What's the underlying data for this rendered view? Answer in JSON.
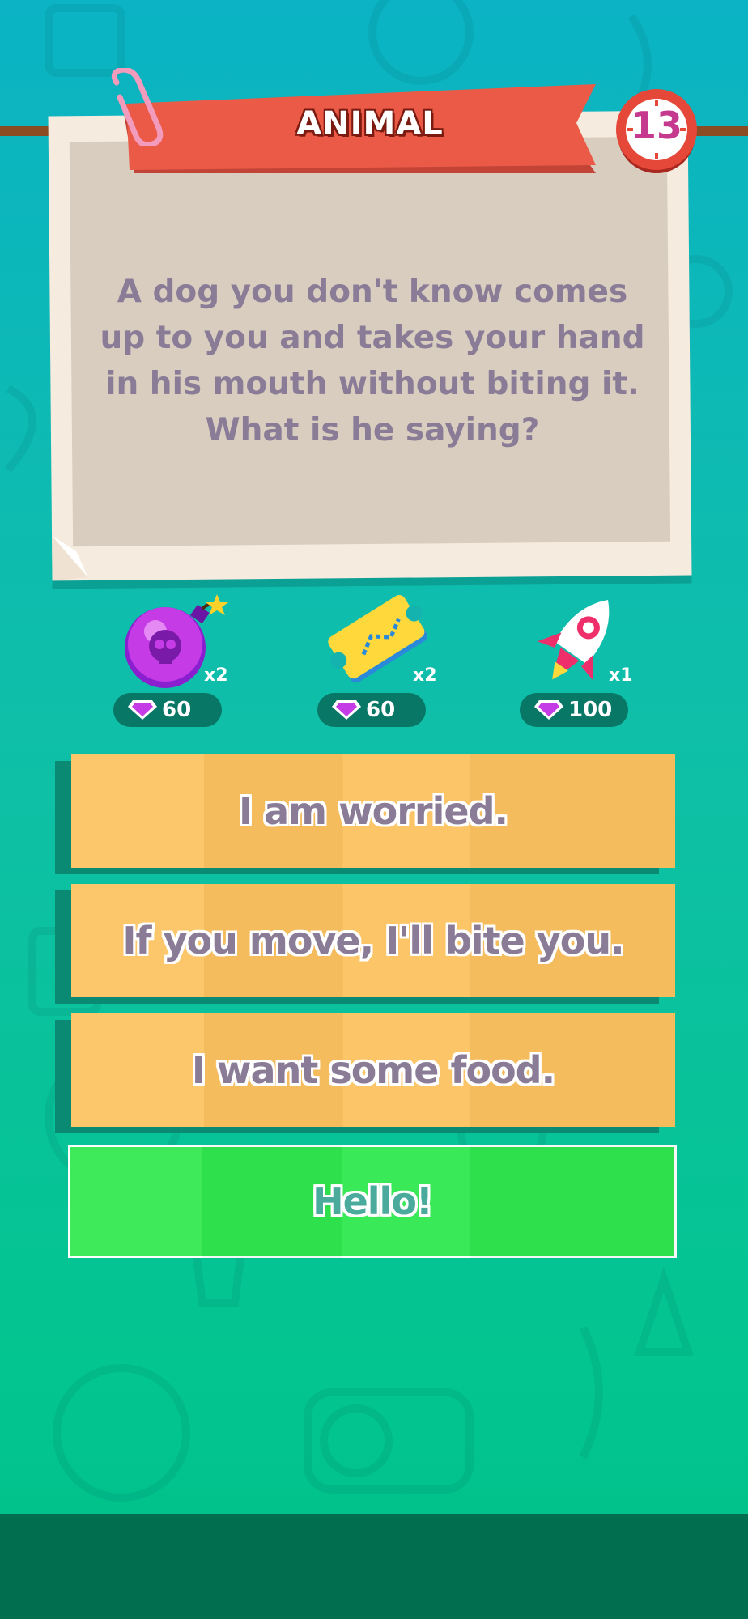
{
  "category": {
    "label": "ANIMAL"
  },
  "timer": {
    "value": "13"
  },
  "question": {
    "text": "A dog you don't know comes up to you and takes your hand in his mouth without biting it. What is he saying?"
  },
  "powerups": [
    {
      "name": "bomb",
      "icon": "skull-bomb-icon",
      "count": "x2",
      "price": "60"
    },
    {
      "name": "ticket",
      "icon": "swap-ticket-icon",
      "count": "x2",
      "price": "60"
    },
    {
      "name": "rocket",
      "icon": "rocket-icon",
      "count": "x1",
      "price": "100"
    }
  ],
  "answers": [
    {
      "label": "I am worried.",
      "state": "default"
    },
    {
      "label": "If you move, I'll bite you.",
      "state": "default"
    },
    {
      "label": "I want some food.",
      "state": "default"
    },
    {
      "label": "Hello!",
      "state": "correct"
    }
  ],
  "colors": {
    "banner": "#ea5a46",
    "card": "#f6ebdf",
    "answer": "#fcc25f",
    "correct": "#2fe84e",
    "text": "#8a7c96"
  }
}
